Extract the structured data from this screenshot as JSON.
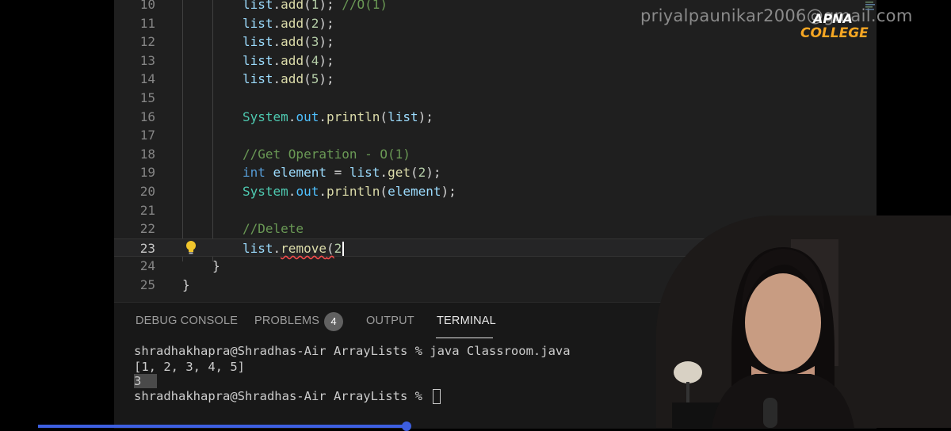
{
  "watermark": "priyalpaunikar2006@gmail.com",
  "logo": {
    "line1": "APNA",
    "line2": "COLLEGE"
  },
  "editor": {
    "line_numbers": [
      "10",
      "11",
      "12",
      "13",
      "14",
      "15",
      "16",
      "17",
      "18",
      "19",
      "20",
      "21",
      "22",
      "23",
      "24",
      "25"
    ],
    "current_line": "23"
  },
  "panel": {
    "tabs": [
      {
        "label": "DEBUG CONSOLE"
      },
      {
        "label": "PROBLEMS",
        "badge": "4"
      },
      {
        "label": "OUTPUT"
      },
      {
        "label": "TERMINAL",
        "active": true
      }
    ],
    "terminal": [
      "shradhakhapra@Shradhas-Air ArrayLists % java Classroom.java",
      "[1, 2, 3, 4, 5]",
      "3",
      "shradhakhapra@Shradhas-Air ArrayLists % "
    ]
  },
  "icons": {
    "lightbulb": "lightbulb-icon"
  },
  "colors": {
    "accent": "#3d5fe0",
    "logo_orange": "#f5a623"
  },
  "video": {
    "progress_fraction": 0.39
  }
}
